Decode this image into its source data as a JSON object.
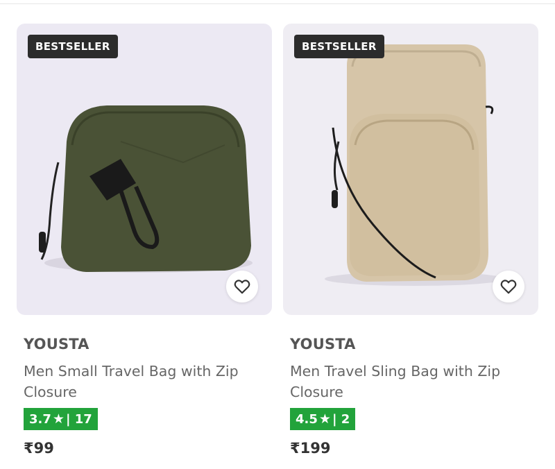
{
  "products": [
    {
      "badge": "BESTSELLER",
      "brand": "YOUSTA",
      "title": "Men Small Travel Bag with Zip Closure",
      "rating": "3.7",
      "reviews_sep": "| 17",
      "price": "₹99",
      "image_color": "#4a5236"
    },
    {
      "badge": "BESTSELLER",
      "brand": "YOUSTA",
      "title": "Men Travel Sling Bag with Zip Closure",
      "rating": "4.5",
      "reviews_sep": "| 2",
      "price": "₹199",
      "image_color": "#d6c5a8"
    }
  ],
  "icons": {
    "wishlist": "heart-outline-icon",
    "rating_star": "star-icon"
  },
  "colors": {
    "rating_bg": "#22a33b",
    "badge_bg": "#2c2c2c"
  }
}
